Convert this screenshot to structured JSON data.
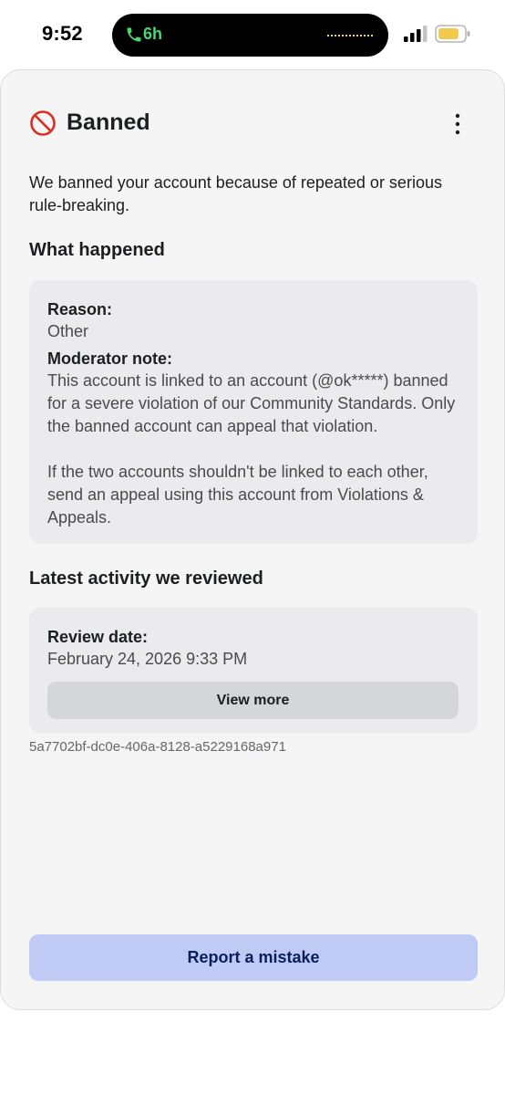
{
  "status_bar": {
    "time": "9:52",
    "activity_label": "6h",
    "icons": [
      "phone-icon",
      "cellular-signal-icon",
      "battery-icon"
    ],
    "activity_color": "#4ad66d",
    "battery_color": "#f2c94c"
  },
  "header": {
    "title": "Banned",
    "icon": "ban-icon",
    "menu_icon": "more-vertical-icon"
  },
  "intro": "We banned your account because of repeated or serious rule-breaking.",
  "what_happened": {
    "heading": "What happened",
    "reason_label": "Reason:",
    "reason_value": "Other",
    "note_label": "Moderator note:",
    "note_paragraphs": [
      "This account is linked to an account (@ok*****) banned for a severe violation of our Community Standards. Only the banned account can appeal that violation.",
      "If the two accounts shouldn't be linked to each other, send an appeal using this account from Violations & Appeals."
    ]
  },
  "latest_activity": {
    "heading": "Latest activity we reviewed",
    "review_date_label": "Review date:",
    "review_date_value": "February 24, 2026 9:33 PM",
    "view_more_label": "View more"
  },
  "reference_id": "5a7702bf-dc0e-406a-8128-a5229168a971",
  "footer": {
    "report_label": "Report a mistake"
  },
  "colors": {
    "sheet_background": "#f5f5f5",
    "card_background": "#ebebed",
    "primary_button": "#bfcbf5",
    "primary_button_text": "#0b1d5c",
    "ban_icon": "#d93025"
  }
}
